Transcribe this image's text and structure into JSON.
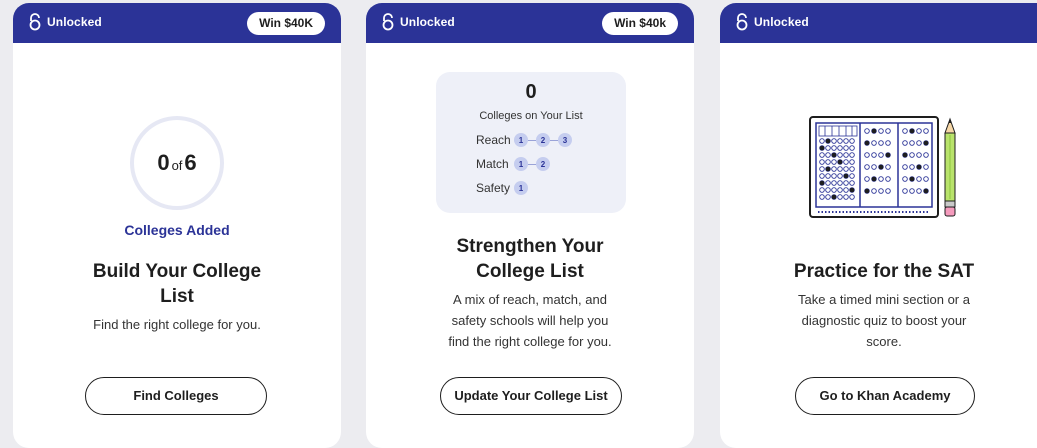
{
  "cards": [
    {
      "status": "Unlocked",
      "badge": "Win $40K",
      "progress": {
        "count": "0",
        "of": "of",
        "total": "6",
        "label": "Colleges Added"
      },
      "title_line1": "Build Your College",
      "title_line2": "List",
      "description_line1": "Find the right college for you.",
      "button": "Find Colleges"
    },
    {
      "status": "Unlocked",
      "badge": "Win $40k",
      "list_summary": {
        "count": "0",
        "label": "Colleges on Your List",
        "tiers": [
          {
            "name": "Reach",
            "slots": [
              "1",
              "2",
              "3"
            ]
          },
          {
            "name": "Match",
            "slots": [
              "1",
              "2"
            ]
          },
          {
            "name": "Safety",
            "slots": [
              "1"
            ]
          }
        ]
      },
      "title_line1": "Strengthen Your",
      "title_line2": "College List",
      "description_line1": "A mix of reach, match, and",
      "description_line2": "safety schools will help you",
      "description_line3": "find the right college for you.",
      "button": "Update Your College List"
    },
    {
      "status": "Unlocked",
      "title_line1": "Practice for the SAT",
      "description_line1": "Take a timed mini section or a",
      "description_line2": "diagnostic quiz to boost your",
      "description_line3": "score.",
      "button": "Go to Khan Academy"
    }
  ],
  "colors": {
    "header": "#2b3397",
    "accent": "#2b3397",
    "page_background": "#ececf0"
  },
  "icons": [
    "unlock-icon",
    "test-sheet-illustration",
    "pencil-illustration"
  ]
}
